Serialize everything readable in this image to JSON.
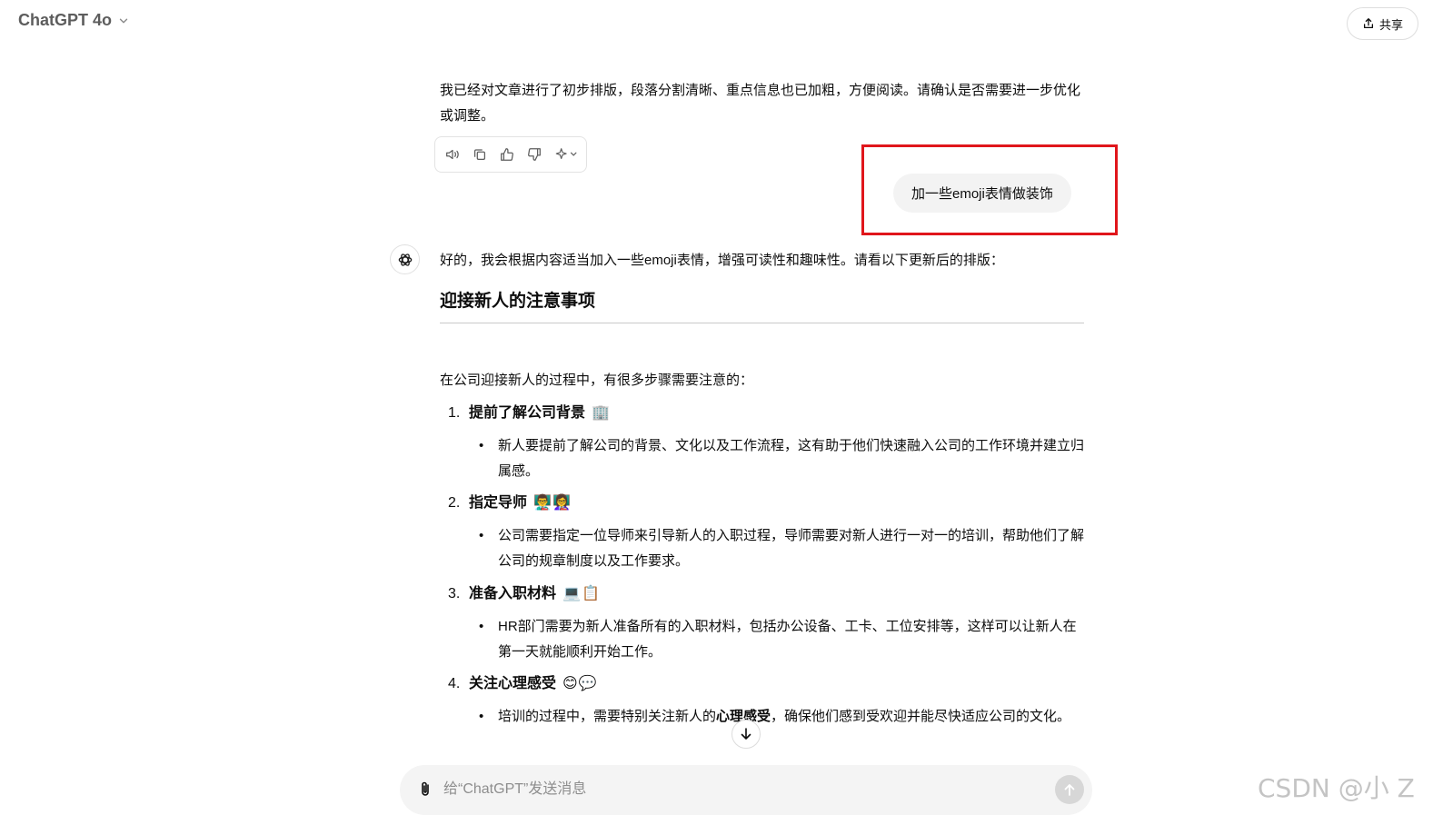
{
  "header": {
    "model_title": "ChatGPT 4o",
    "share_label": "共享"
  },
  "previous_reply": {
    "text": "我已经对文章进行了初步排版，段落分割清晰、重点信息也已加粗，方便阅读。请确认是否需要进一步优化或调整。"
  },
  "user_message": {
    "text": "加一些emoji表情做装饰"
  },
  "reply": {
    "intro": "好的，我会根据内容适当加入一些emoji表情，增强可读性和趣味性。请看以下更新后的排版：",
    "heading": "迎接新人的注意事项",
    "paragraph": "在公司迎接新人的过程中，有很多步骤需要注意的：",
    "items": [
      {
        "num": "1.",
        "title": "提前了解公司背景",
        "emoji": "🏢",
        "bullet_text": "新人要提前了解公司的背景、文化以及工作流程，这有助于他们快速融入公司的工作环境并建立归属感。"
      },
      {
        "num": "2.",
        "title": "指定导师",
        "emoji": "👨‍🏫👩‍🏫",
        "bullet_text": "公司需要指定一位导师来引导新人的入职过程，导师需要对新人进行一对一的培训，帮助他们了解公司的规章制度以及工作要求。"
      },
      {
        "num": "3.",
        "title": "准备入职材料",
        "emoji": "💻📋",
        "bullet_text": "HR部门需要为新人准备所有的入职材料，包括办公设备、工卡、工位安排等，这样可以让新人在第一天就能顺利开始工作。"
      },
      {
        "num": "4.",
        "title": "关注心理感受",
        "emoji": "😊💬",
        "bullet_pre": "培训的过程中，需要特别关注新人的",
        "bullet_bold": "心理感受",
        "bullet_post": "，确保他们感到受欢迎并能尽快适应公司的文化。"
      }
    ]
  },
  "composer": {
    "placeholder": "给“ChatGPT”发送消息"
  },
  "watermark": "CSDN @小 Z",
  "icons": {
    "chevron": "chevron-down-icon",
    "share": "share-icon",
    "read_aloud": "speaker-icon",
    "copy": "copy-icon",
    "like": "thumbs-up-icon",
    "dislike": "thumbs-down-icon",
    "regenerate": "sparkle-icon",
    "avatar": "openai-logo-icon",
    "scroll": "arrow-down-icon",
    "attach": "paperclip-icon",
    "send": "arrow-up-icon"
  },
  "colors": {
    "highlight_box": "#e0161b",
    "user_bubble": "#f3f3f3",
    "composer_bg": "#f4f4f4"
  }
}
